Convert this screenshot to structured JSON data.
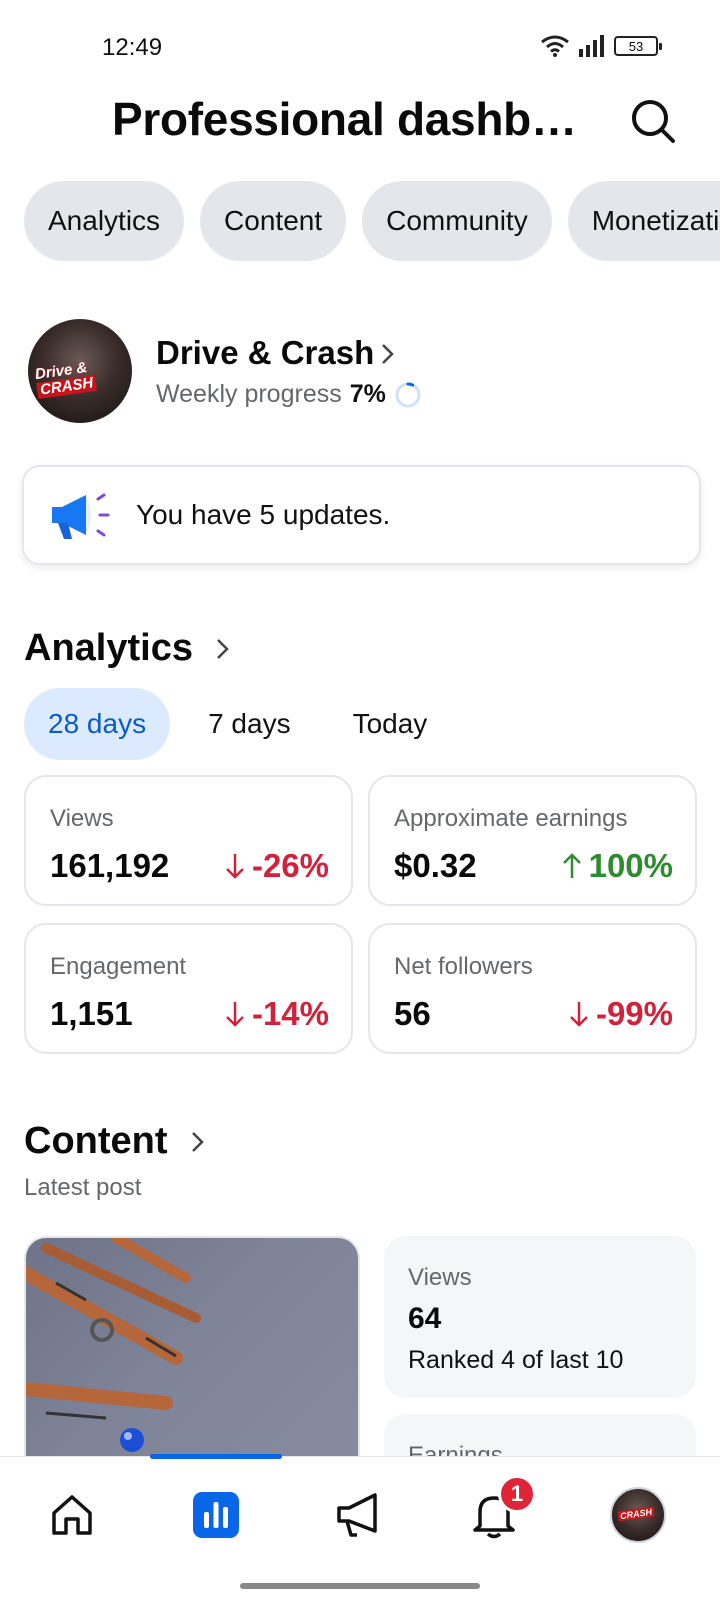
{
  "status_bar": {
    "time": "12:49",
    "battery": "53"
  },
  "header": {
    "title": "Professional dashboard"
  },
  "tabs": [
    {
      "label": "Analytics"
    },
    {
      "label": "Content"
    },
    {
      "label": "Community"
    },
    {
      "label": "Monetization"
    }
  ],
  "profile": {
    "name": "Drive & Crash",
    "avatar_text_1": "Drive &",
    "avatar_text_2": "CRASH",
    "progress_label": "Weekly progress",
    "progress_value": "7%",
    "progress_fraction": 0.07
  },
  "updates": {
    "text": "You have 5 updates."
  },
  "analytics": {
    "title": "Analytics",
    "ranges": [
      {
        "label": "28 days",
        "active": true
      },
      {
        "label": "7 days",
        "active": false
      },
      {
        "label": "Today",
        "active": false
      }
    ],
    "metrics": [
      {
        "label": "Views",
        "value": "161,192",
        "change": "-26%",
        "direction": "down"
      },
      {
        "label": "Approximate earnings",
        "value": "$0.32",
        "change": "100%",
        "direction": "up"
      },
      {
        "label": "Engagement",
        "value": "1,151",
        "change": "-14%",
        "direction": "down"
      },
      {
        "label": "Net followers",
        "value": "56",
        "change": "-99%",
        "direction": "down"
      }
    ]
  },
  "content": {
    "title": "Content",
    "subtitle": "Latest post",
    "views_label": "Views",
    "views_value": "64",
    "views_rank": "Ranked 4 of last 10",
    "earnings_label": "Earnings"
  },
  "bottom_nav": {
    "items": [
      "home-icon",
      "dashboard-icon",
      "megaphone-icon",
      "bell-icon",
      "profile-avatar"
    ],
    "active": "dashboard-icon",
    "notification_count": "1"
  },
  "colors": {
    "accent_blue": "#0a66e8",
    "down_red": "#d0223a",
    "up_green": "#2e8b2e",
    "tab_bg": "#e4e6eb",
    "range_active_bg": "#dbeafe"
  }
}
